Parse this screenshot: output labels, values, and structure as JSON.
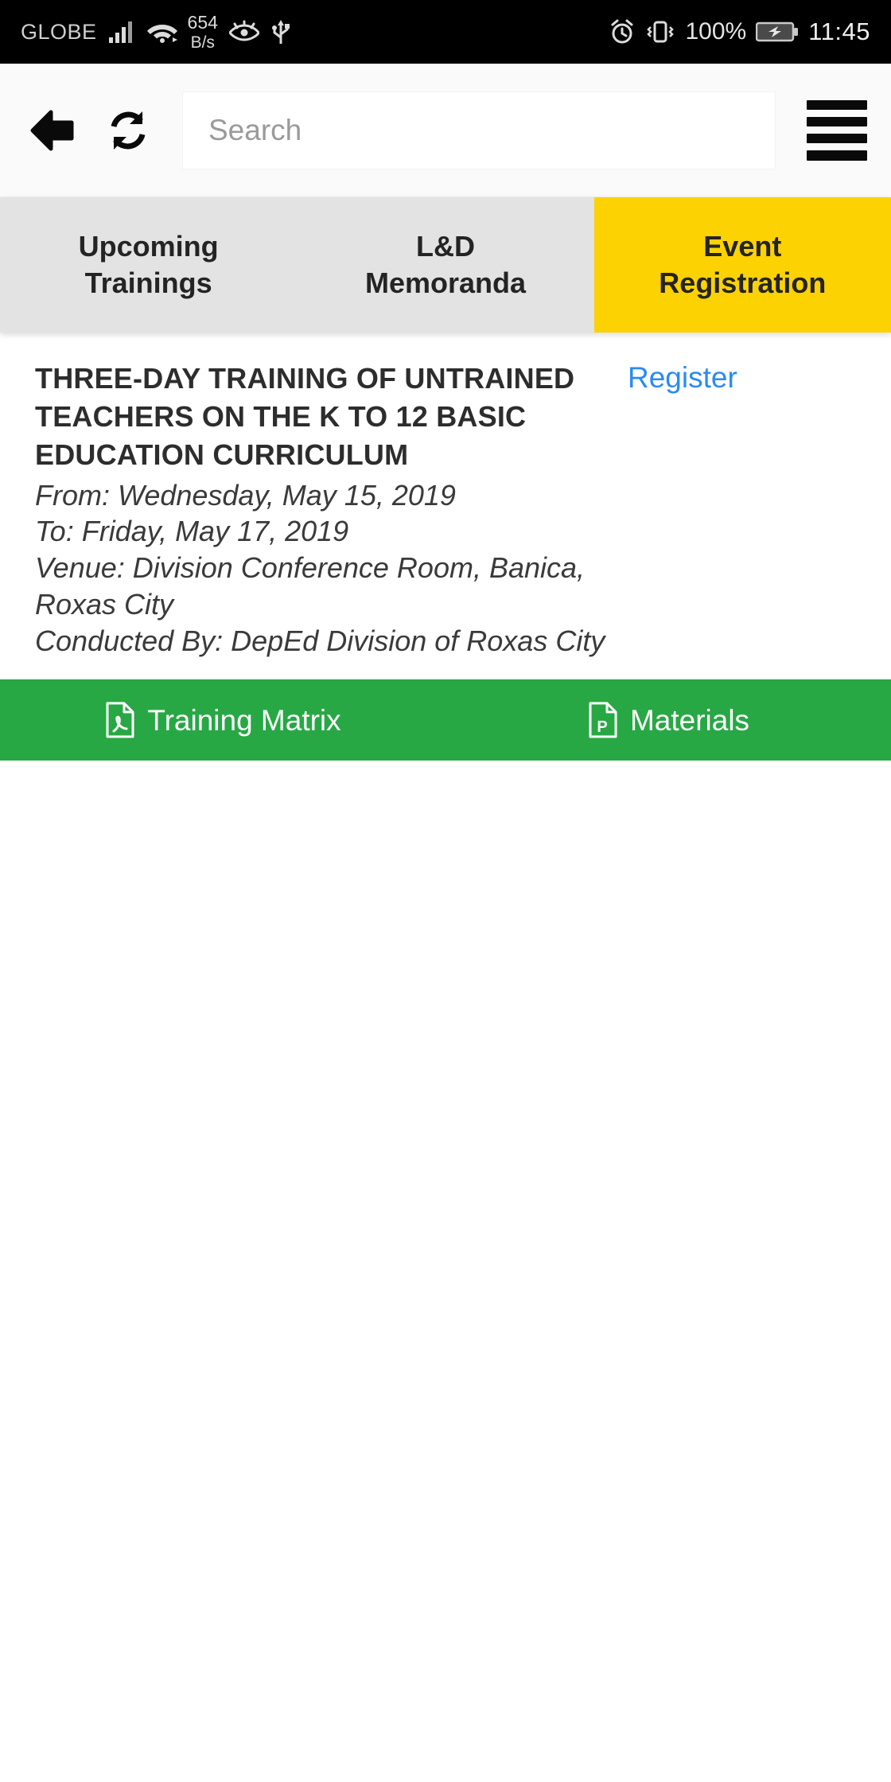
{
  "statusbar": {
    "carrier": "GLOBE",
    "signal_icon": "cellular-signal-icon",
    "wifi_icon": "wifi-icon",
    "network_speed_value": "654",
    "network_speed_unit": "B/s",
    "eye_icon": "eye-care-icon",
    "usb_icon": "usb-icon",
    "alarm_icon": "alarm-clock-icon",
    "vibrate_icon": "vibrate-icon",
    "battery_percent": "100%",
    "battery_icon": "battery-charging-icon",
    "time": "11:45"
  },
  "toolbar": {
    "back_icon": "back-arrow-icon",
    "refresh_icon": "refresh-icon",
    "menu_icon": "hamburger-menu-icon",
    "search_placeholder": "Search",
    "search_value": ""
  },
  "tabs": [
    {
      "line1": "Upcoming",
      "line2": "Trainings",
      "active": false
    },
    {
      "line1": "L&D",
      "line2": "Memoranda",
      "active": false
    },
    {
      "line1": "Event",
      "line2": "Registration",
      "active": true
    }
  ],
  "event": {
    "title": "THREE-DAY TRAINING OF UNTRAINED TEACHERS ON THE K TO 12 BASIC EDUCATION CURRICULUM",
    "register_label": "Register",
    "from": "From: Wednesday, May 15, 2019",
    "to": "To: Friday, May 17, 2019",
    "venue": "Venue: Division Conference Room, Banica, Roxas City",
    "conducted_by": "Conducted By: DepEd Division of Roxas City"
  },
  "actions": [
    {
      "label": "Training Matrix",
      "icon": "pdf-file-icon"
    },
    {
      "label": "Materials",
      "icon": "powerpoint-file-icon"
    }
  ],
  "colors": {
    "tab_active": "#FCD202",
    "tab_inactive": "#E3E3E3",
    "action_bar_green": "#27A844",
    "link_blue": "#2A8BF2",
    "statusbar_black": "#000000"
  }
}
